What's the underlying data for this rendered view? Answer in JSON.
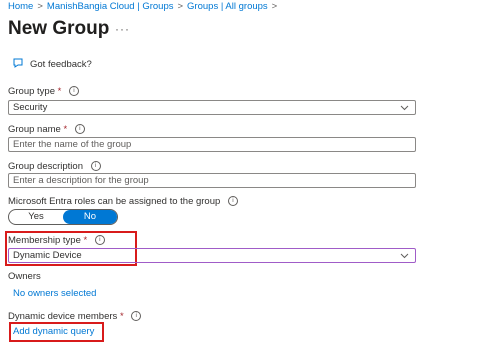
{
  "breadcrumb": {
    "items": [
      "Home",
      "ManishBangia Cloud | Groups",
      "Groups | All groups"
    ],
    "separator": ">"
  },
  "page": {
    "title": "New Group",
    "more": "···"
  },
  "feedback": {
    "label": "Got feedback?"
  },
  "group_type": {
    "label": "Group type",
    "required": "*",
    "value": "Security"
  },
  "group_name": {
    "label": "Group name",
    "required": "*",
    "placeholder": "Enter the name of the group"
  },
  "group_description": {
    "label": "Group description",
    "placeholder": "Enter a description for the group"
  },
  "entra_roles": {
    "label": "Microsoft Entra roles can be assigned to the group",
    "options": [
      "Yes",
      "No"
    ],
    "selected": "No"
  },
  "membership_type": {
    "label": "Membership type",
    "required": "*",
    "value": "Dynamic Device"
  },
  "owners": {
    "label": "Owners",
    "value": "No owners selected"
  },
  "dynamic_members": {
    "label": "Dynamic device members",
    "required": "*",
    "link": "Add dynamic query"
  },
  "colors": {
    "accent": "#0078d4",
    "required": "#a4262c",
    "highlight": "#d81b1b"
  }
}
